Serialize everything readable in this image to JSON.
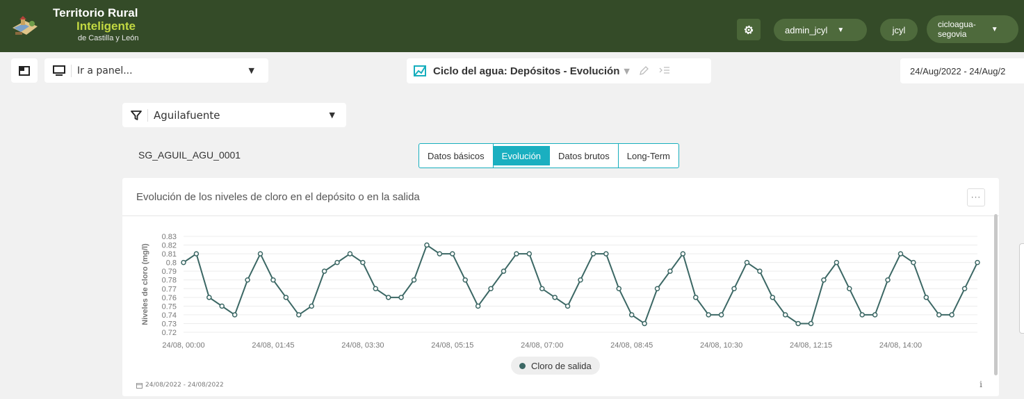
{
  "header": {
    "brand_line1": "Territorio Rural",
    "brand_line2": "Inteligente",
    "brand_line3": "de Castilla y León",
    "user": "admin_jcyl",
    "organization": "jcyl",
    "namespace_line1": "cicloagua-",
    "namespace_line2": "segovia",
    "settings_icon": "gear-icon",
    "accent_color": "#c2d842",
    "bar_color": "#344b28"
  },
  "toolbar": {
    "panel_placeholder": "Ir a panel...",
    "dashboard_title": "Ciclo del agua: Depósitos - Evolución",
    "date_range": "24/Aug/2022 - 24/Aug/2"
  },
  "filter": {
    "selected": "Aguilafuente"
  },
  "device_id": "SG_AGUIL_AGU_0001",
  "tabs": [
    {
      "label": "Datos básicos",
      "active": false
    },
    {
      "label": "Evolución",
      "active": true
    },
    {
      "label": "Datos brutos",
      "active": false
    },
    {
      "label": "Long-Term",
      "active": false
    }
  ],
  "card": {
    "title": "Evolución de los niveles de cloro en el depósito o en la salida",
    "menu_label": "···",
    "footer_date": "24/08/2022 - 24/08/2022",
    "info_label": "i"
  },
  "chart_data": {
    "type": "line",
    "ylabel": "Niveles de cloro (mg/l)",
    "xlabel": "",
    "ylim": [
      0.72,
      0.83
    ],
    "yticks": [
      "0.83",
      "0.82",
      "0.81",
      "0.8",
      "0.79",
      "0.78",
      "0.77",
      "0.76",
      "0.75",
      "0.74",
      "0.73",
      "0.72"
    ],
    "xtick_labels": [
      "24/08, 00:00",
      "24/08, 01:45",
      "24/08, 03:30",
      "24/08, 05:15",
      "24/08, 07:00",
      "24/08, 08:45",
      "24/08, 10:30",
      "24/08, 12:15",
      "24/08, 14:00"
    ],
    "xtick_positions_minutes": [
      0,
      105,
      210,
      315,
      420,
      525,
      630,
      735,
      840
    ],
    "interval_minutes": 15,
    "grid": true,
    "legend_position": "bottom-center",
    "series": [
      {
        "name": "Cloro de salida",
        "color": "#3b6764",
        "values": [
          0.8,
          0.81,
          0.76,
          0.75,
          0.74,
          0.78,
          0.81,
          0.78,
          0.76,
          0.74,
          0.75,
          0.79,
          0.8,
          0.81,
          0.8,
          0.77,
          0.76,
          0.76,
          0.78,
          0.82,
          0.81,
          0.81,
          0.78,
          0.75,
          0.77,
          0.79,
          0.81,
          0.81,
          0.77,
          0.76,
          0.75,
          0.78,
          0.81,
          0.81,
          0.77,
          0.74,
          0.73,
          0.77,
          0.79,
          0.81,
          0.76,
          0.74,
          0.74,
          0.77,
          0.8,
          0.79,
          0.76,
          0.74,
          0.73,
          0.73,
          0.78,
          0.8,
          0.77,
          0.74,
          0.74,
          0.78,
          0.81,
          0.8,
          0.76,
          0.74,
          0.74,
          0.77,
          0.8
        ]
      }
    ]
  }
}
